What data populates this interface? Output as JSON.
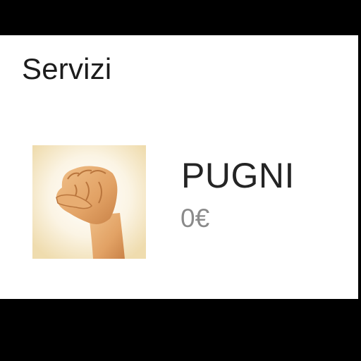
{
  "section": {
    "title": "Servizi"
  },
  "services": [
    {
      "name": "PUGNI",
      "price": "0€",
      "image_icon": "raised-fist-icon"
    }
  ],
  "colors": {
    "panel_background": "#ffffff",
    "frame": "#000000",
    "title_text": "#1c1c1c",
    "price_text": "#8a8a8a"
  }
}
